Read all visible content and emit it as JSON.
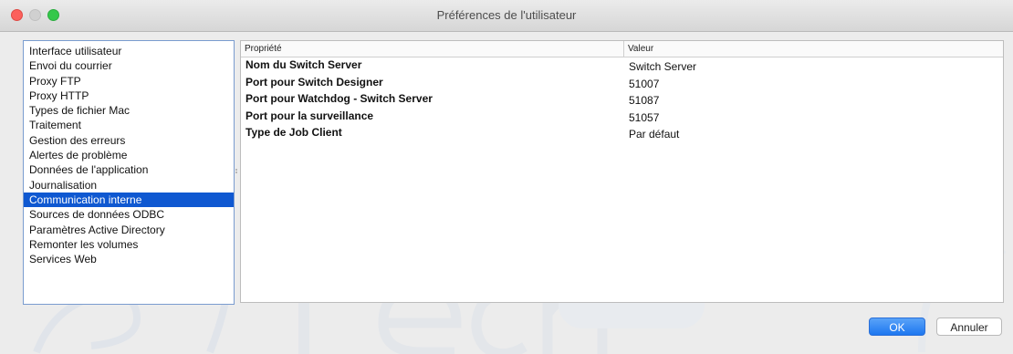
{
  "window": {
    "title": "Préférences de l'utilisateur"
  },
  "categories": [
    {
      "label": "Interface utilisateur"
    },
    {
      "label": "Envoi du courrier"
    },
    {
      "label": "Proxy FTP"
    },
    {
      "label": "Proxy HTTP"
    },
    {
      "label": "Types de fichier Mac"
    },
    {
      "label": "Traitement"
    },
    {
      "label": "Gestion des erreurs"
    },
    {
      "label": "Alertes de problème"
    },
    {
      "label": "Données de l'application"
    },
    {
      "label": "Journalisation"
    },
    {
      "label": "Communication interne",
      "selected": true
    },
    {
      "label": "Sources de données ODBC"
    },
    {
      "label": "Paramètres Active Directory"
    },
    {
      "label": "Remonter les volumes"
    },
    {
      "label": "Services Web"
    }
  ],
  "properties": {
    "headers": {
      "property": "Propriété",
      "value": "Valeur"
    },
    "rows": [
      {
        "name": "Nom du Switch Server",
        "value": "Switch Server"
      },
      {
        "name": "Port pour Switch Designer",
        "value": "51007"
      },
      {
        "name": "Port pour Watchdog - Switch Server",
        "value": "51087"
      },
      {
        "name": "Port pour la surveillance",
        "value": "51057"
      },
      {
        "name": "Type de Job Client",
        "value": "Par défaut"
      }
    ]
  },
  "buttons": {
    "ok": "OK",
    "cancel": "Annuler"
  },
  "colors": {
    "selection": "#0f58d1",
    "accent": "#1d77f0"
  }
}
